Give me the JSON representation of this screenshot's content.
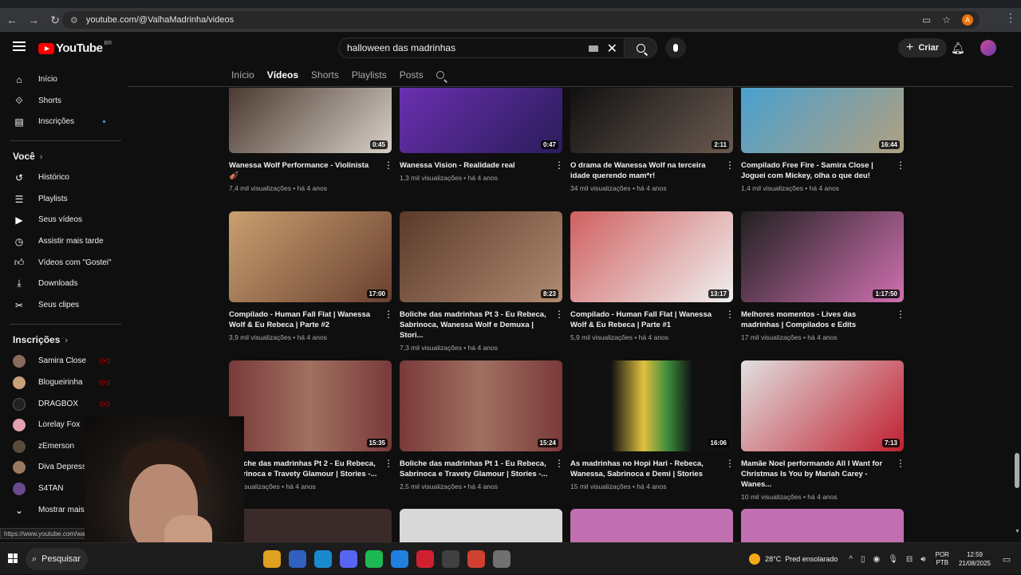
{
  "browser": {
    "url": "youtube.com/@ValhaMadrinha/videos",
    "profile_initial": "A",
    "status_url": "https://www.youtube.com/watch?"
  },
  "header": {
    "logo_text": "YouTube",
    "logo_region": "BR",
    "search_value": "halloween das madrinhas",
    "create_label": "Criar"
  },
  "tabs": [
    "Início",
    "Vídeos",
    "Shorts",
    "Playlists",
    "Posts"
  ],
  "sidebar": {
    "main": [
      {
        "label": "Início",
        "icon": "home-icon"
      },
      {
        "label": "Shorts",
        "icon": "shorts-icon"
      },
      {
        "label": "Inscrições",
        "icon": "subscriptions-icon"
      }
    ],
    "you_title": "Você",
    "you": [
      {
        "label": "Histórico",
        "icon": "history-icon"
      },
      {
        "label": "Playlists",
        "icon": "playlists-icon"
      },
      {
        "label": "Seus vídeos",
        "icon": "your-videos-icon"
      },
      {
        "label": "Assistir mais tarde",
        "icon": "watch-later-icon"
      },
      {
        "label": "Vídeos com \"Gostei\"",
        "icon": "liked-icon"
      },
      {
        "label": "Downloads",
        "icon": "downloads-icon"
      },
      {
        "label": "Seus clipes",
        "icon": "clips-icon"
      }
    ],
    "subs_title": "Inscrições",
    "subs": [
      {
        "label": "Samira Close",
        "color": "#8a6a5a"
      },
      {
        "label": "Blogueirinha",
        "color": "#c9a27a"
      },
      {
        "label": "DRAGBOX",
        "color": "#222222"
      },
      {
        "label": "Lorelay Fox",
        "color": "#e3a0b0"
      },
      {
        "label": "zEmerson",
        "color": "#5a4a3a"
      },
      {
        "label": "Diva Depressão",
        "color": "#9a7a60"
      },
      {
        "label": "S4TAN",
        "color": "#6a4a8a"
      }
    ],
    "show_more": "Mostrar mais"
  },
  "videos": [
    {
      "title": "Wanessa Wolf Performance - Violinista 🎻",
      "meta": "7,4 mil visualizações • há 4 anos",
      "duration": "0:45",
      "bg": "linear-gradient(135deg,#4a3a30,#d8d0c8)"
    },
    {
      "title": "Wanessa Vision - Realidade real",
      "meta": "1,3 mil visualizações • há 4 anos",
      "duration": "0:47",
      "bg": "linear-gradient(135deg,#6a2fb0,#2a1d5a)"
    },
    {
      "title": "O drama de Wanessa Wolf na terceira idade querendo mam*r!",
      "meta": "34 mil visualizações • há 4 anos",
      "duration": "2:11",
      "bg": "linear-gradient(135deg,#111,#6a5a50)"
    },
    {
      "title": "Compilado Free Fire - Samira Close | Joguei com Mickey, olha o que deu!",
      "meta": "1,4 mil visualizações • há 4 anos",
      "duration": "16:44",
      "bg": "linear-gradient(135deg,#4aa0d0,#b0a080)"
    },
    {
      "title": "Compilado - Human Fall Flat | Wanessa Wolf & Eu Rebeca | Parte #2",
      "meta": "3,9 mil visualizações • há 4 anos",
      "duration": "17:00",
      "bg": "linear-gradient(135deg,#c8a070,#6a4030)"
    },
    {
      "title": "Boliche das madrinhas Pt 3 - Eu Rebeca, Sabrinoca, Wanessa Wolf e Demuxa | Stori...",
      "meta": "7,3 mil visualizações • há 4 anos",
      "duration": "8:23",
      "bg": "linear-gradient(135deg,#5a3a2a,#b08a70)"
    },
    {
      "title": "Compilado - Human Fall Flat | Wanessa Wolf & Eu Rebeca | Parte #1",
      "meta": "5,9 mil visualizações • há 4 anos",
      "duration": "13:17",
      "bg": "linear-gradient(135deg,#d06060,#f0f0f0)"
    },
    {
      "title": "Melhores momentos - Lives das madrinhas | Compilados e Edits",
      "meta": "17 mil visualizações • há 4 anos",
      "duration": "1:17:50",
      "bg": "linear-gradient(135deg,#202020,#d070b0)"
    },
    {
      "title": "Boliche das madrinhas Pt 2 - Eu Rebeca, Sabrinoca e Travety Glamour | Stories -...",
      "meta": "mil visualizações • há 4 anos",
      "duration": "15:35",
      "bg": "linear-gradient(90deg,#7a3a3a,#a07060,#7a3a3a)"
    },
    {
      "title": "Boliche das madrinhas Pt 1 - Eu Rebeca, Sabrinoca e Travety Glamour | Stories -...",
      "meta": "2,5 mil visualizações • há 4 anos",
      "duration": "15:24",
      "bg": "linear-gradient(90deg,#7a3a3a,#a07060,#7a3a3a)"
    },
    {
      "title": "As madrinhas no Hopi Hari - Rebeca, Wanessa, Sabrinoca e Demi | Stories",
      "meta": "15 mil visualizações • há 4 anos",
      "duration": "16:06",
      "bg": "linear-gradient(90deg,#111 25%,#e0c040 45%,#3a8a3a 60%,#111 75%)"
    },
    {
      "title": "Mamãe Noel performando All I Want for Christmas Is You by Mariah Carey - Wanes...",
      "meta": "10 mil visualizações • há 4 anos",
      "duration": "7:13",
      "bg": "linear-gradient(135deg,#e0e0e0,#c02030)"
    }
  ],
  "next_row_bg": [
    "#3a2a2a",
    "#d8d8d8",
    "#c070b0",
    "#c070b0"
  ],
  "taskbar": {
    "search_label": "Pesquisar",
    "weather": "28°C",
    "weather_desc": "Pred ensolarado",
    "lang_1": "POR",
    "lang_2": "PTB",
    "time": "12:59",
    "date": "21/08/2025",
    "apps": [
      {
        "icon": "chrome-canary-icon",
        "color": "#e0a020"
      },
      {
        "icon": "app-blue-icon",
        "color": "#3060c0"
      },
      {
        "icon": "edge-icon",
        "color": "#1a8ad0"
      },
      {
        "icon": "discord-icon",
        "color": "#5865f2"
      },
      {
        "icon": "spotify-icon",
        "color": "#1db954"
      },
      {
        "icon": "app-blue2-icon",
        "color": "#2080e0"
      },
      {
        "icon": "app-red-icon",
        "color": "#d02030"
      },
      {
        "icon": "app-gray-icon",
        "color": "#404040"
      },
      {
        "icon": "chrome-icon",
        "color": "#d04030"
      },
      {
        "icon": "app-shield-icon",
        "color": "#707070"
      }
    ]
  }
}
